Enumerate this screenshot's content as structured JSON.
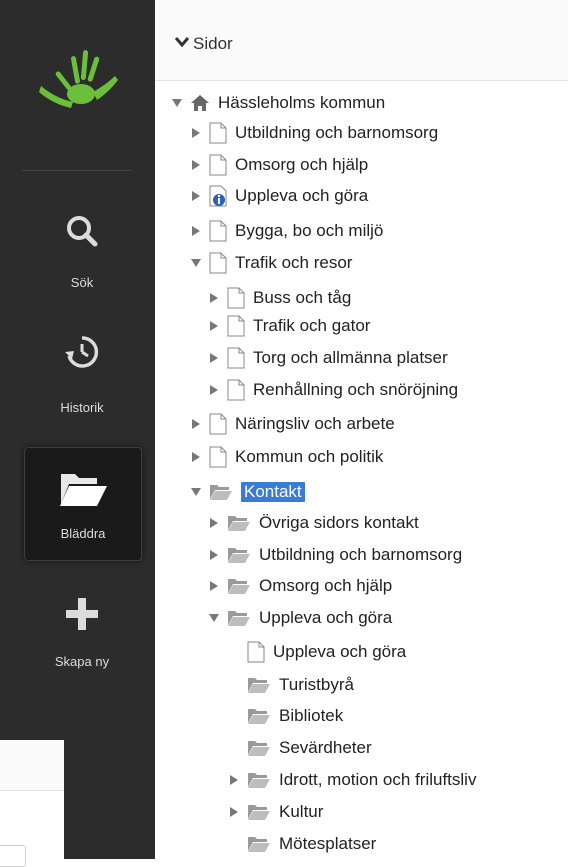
{
  "sidebar": {
    "logo": "hand-logo",
    "items": [
      {
        "key": "search",
        "label": "Sök",
        "icon": "search-icon"
      },
      {
        "key": "history",
        "label": "Historik",
        "icon": "history-icon"
      },
      {
        "key": "browse",
        "label": "Bläddra",
        "icon": "folder-open-icon",
        "active": true
      },
      {
        "key": "create",
        "label": "Skapa ny",
        "icon": "plus-icon"
      }
    ],
    "colors": {
      "background": "#2c2c2c",
      "active": "#1a1a1a",
      "logo_green": "#6bbf3a",
      "text": "#dcdcdc"
    }
  },
  "panel": {
    "header": {
      "title": "Sidor",
      "icon": "chevron-down-icon"
    },
    "selection_color": "#3a7bd5"
  },
  "tree": [
    {
      "label": "Hässleholms kommun",
      "toggle": "open",
      "icon": "home-icon"
    },
    {
      "label": "Utbildning och barnomsorg",
      "toggle": "closed",
      "icon": "page-icon"
    },
    {
      "label": "Omsorg och hjälp",
      "toggle": "closed",
      "icon": "page-icon"
    },
    {
      "label": "Uppleva och göra",
      "toggle": "closed",
      "icon": "page-info-icon"
    },
    {
      "label": "Bygga, bo och miljö",
      "toggle": "closed",
      "icon": "page-icon"
    },
    {
      "label": "Trafik och resor",
      "toggle": "open",
      "icon": "page-icon"
    },
    {
      "label": "Buss och tåg",
      "toggle": "closed",
      "icon": "page-icon"
    },
    {
      "label": "Trafik och gator",
      "toggle": "closed",
      "icon": "page-icon"
    },
    {
      "label": "Torg och allmänna platser",
      "toggle": "closed",
      "icon": "page-icon"
    },
    {
      "label": "Renhållning och snöröjning",
      "toggle": "closed",
      "icon": "page-icon"
    },
    {
      "label": "Näringsliv och arbete",
      "toggle": "closed",
      "icon": "page-icon"
    },
    {
      "label": "Kommun och politik",
      "toggle": "closed",
      "icon": "page-icon"
    },
    {
      "label": "Kontakt",
      "toggle": "open",
      "icon": "folder-open-icon",
      "selected": true
    },
    {
      "label": "Övriga sidors kontakt",
      "toggle": "closed",
      "icon": "folder-open-icon"
    },
    {
      "label": "Utbildning och barnomsorg",
      "toggle": "closed",
      "icon": "folder-open-icon"
    },
    {
      "label": "Omsorg och hjälp",
      "toggle": "closed",
      "icon": "folder-open-icon"
    },
    {
      "label": "Uppleva och göra",
      "toggle": "open",
      "icon": "folder-open-icon"
    },
    {
      "label": "Uppleva och göra",
      "toggle": "none",
      "icon": "page-icon"
    },
    {
      "label": "Turistbyrå",
      "toggle": "none",
      "icon": "folder-open-icon"
    },
    {
      "label": "Bibliotek",
      "toggle": "none",
      "icon": "folder-open-icon"
    },
    {
      "label": "Sevärdheter",
      "toggle": "none",
      "icon": "folder-open-icon"
    },
    {
      "label": "Idrott, motion och friluftsliv",
      "toggle": "closed",
      "icon": "folder-open-icon"
    },
    {
      "label": "Kultur",
      "toggle": "closed",
      "icon": "folder-open-icon"
    },
    {
      "label": "Mötesplatser",
      "toggle": "none",
      "icon": "folder-open-icon"
    }
  ]
}
